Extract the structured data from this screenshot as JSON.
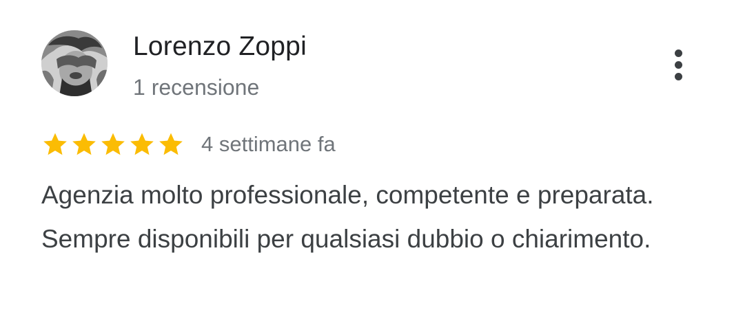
{
  "review": {
    "reviewer_name": "Lorenzo Zoppi",
    "review_count": "1 recensione",
    "rating": 5,
    "rating_max": 5,
    "date": "4 settimane fa",
    "text": "Agenzia molto professionale, competente e preparata. Sempre disponibili per qualsiasi dubbio o chiarimento."
  },
  "icons": {
    "more": "more-vert-icon",
    "star": "star-icon"
  },
  "colors": {
    "star": "#FBBC04",
    "name": "#202124",
    "secondary": "#70757A",
    "body": "#3C4043"
  }
}
